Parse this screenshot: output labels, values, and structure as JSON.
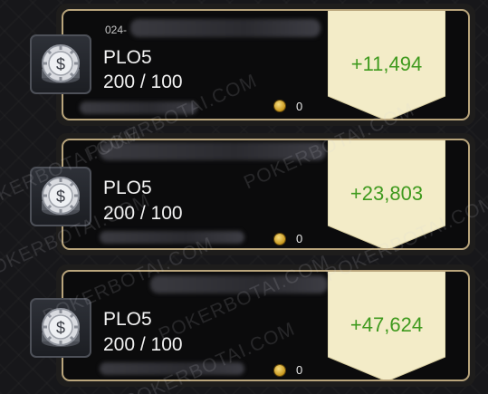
{
  "colors": {
    "card_border": "#b9a57c",
    "tag_fill": "#f3ecc8",
    "profit_green": "#3f9a1e",
    "background": "#17171a"
  },
  "watermark_text": "POKERBOTAI.COM",
  "hands": [
    {
      "date_fragment": "024-",
      "game": "PLO5",
      "stakes": "200 / 100",
      "coin_icon": "gold-coin-icon",
      "coin_count": "0",
      "profit": "+11,494"
    },
    {
      "date_fragment": "",
      "game": "PLO5",
      "stakes": "200 / 100",
      "coin_icon": "gold-coin-icon",
      "coin_count": "0",
      "profit": "+23,803"
    },
    {
      "date_fragment": "",
      "game": "PLO5",
      "stakes": "200 / 100",
      "coin_icon": "gold-coin-icon",
      "coin_count": "0",
      "profit": "+47,624"
    }
  ]
}
